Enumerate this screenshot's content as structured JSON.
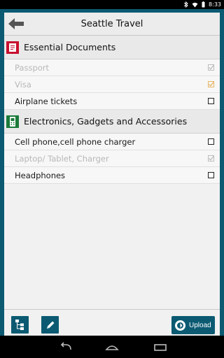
{
  "status_bar": {
    "time": "8:33"
  },
  "header": {
    "title": "Seattle Travel"
  },
  "sections": [
    {
      "title": "Essential Documents",
      "icon": "document-icon",
      "icon_color": "#c8102e",
      "items": [
        {
          "label": "Passport",
          "checked": true
        },
        {
          "label": "Visa",
          "checked": true
        },
        {
          "label": "Airplane tickets",
          "checked": false
        }
      ]
    },
    {
      "title": "Electronics, Gadgets and Accessories",
      "icon": "phone-icon",
      "icon_color": "#1b7a3a",
      "items": [
        {
          "label": "Cell phone,cell phone charger",
          "checked": false
        },
        {
          "label": "Laptop/ Tablet, Charger",
          "checked": true
        },
        {
          "label": "Headphones",
          "checked": false
        }
      ]
    }
  ],
  "toolbar": {
    "upload_label": "Upload",
    "accent": "#0b5a72"
  }
}
